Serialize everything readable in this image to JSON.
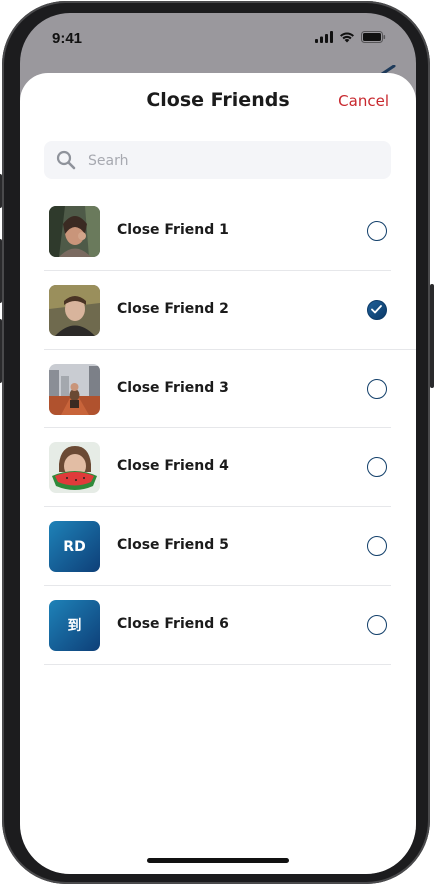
{
  "status": {
    "time": "9:41"
  },
  "header": {
    "title": "Close Friends",
    "cancel_label": "Cancel"
  },
  "search": {
    "placeholder": "Searh"
  },
  "friends": [
    {
      "name": "Close Friend 1",
      "avatar": "photo",
      "checked": false
    },
    {
      "name": "Close Friend 2",
      "avatar": "photo",
      "checked": true
    },
    {
      "name": "Close Friend 3",
      "avatar": "photo",
      "checked": false
    },
    {
      "name": "Close Friend 4",
      "avatar": "photo",
      "checked": false
    },
    {
      "name": "Close Friend 5",
      "avatar": "initials",
      "initials": "RD",
      "checked": false
    },
    {
      "name": "Close Friend 6",
      "avatar": "initials",
      "initials": "到",
      "checked": false
    }
  ],
  "colors": {
    "accent": "#123f6a",
    "cancel": "#c8282e",
    "search_bg": "#f4f5f8"
  }
}
